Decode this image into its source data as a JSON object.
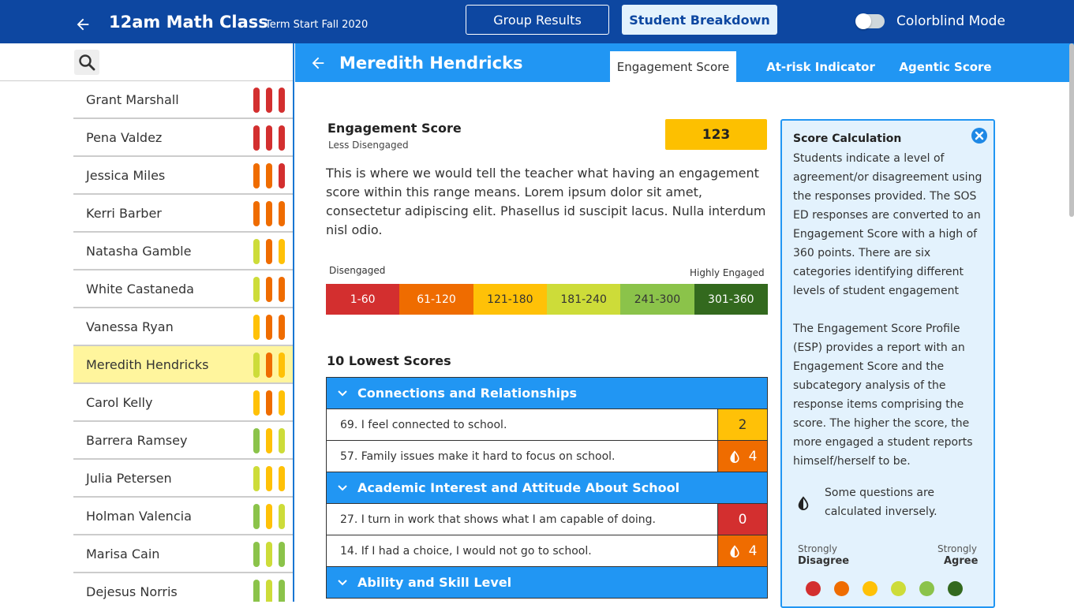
{
  "header": {
    "title": "12am Math Class",
    "term": "Term Start Fall 2020",
    "group_results_label": "Group Results",
    "student_breakdown_label": "Student Breakdown",
    "colorblind_label": "Colorblind Mode",
    "colorblind_on": false
  },
  "sidebar": {
    "students": [
      {
        "name": "Grant Marshall",
        "bars": [
          "#d32f2f",
          "#d32f2f",
          "#d32f2f"
        ]
      },
      {
        "name": "Pena Valdez",
        "bars": [
          "#d32f2f",
          "#d32f2f",
          "#d32f2f"
        ]
      },
      {
        "name": "Jessica Miles",
        "bars": [
          "#ef6c00",
          "#ef6c00",
          "#d32f2f"
        ]
      },
      {
        "name": "Kerri Barber",
        "bars": [
          "#ef6c00",
          "#ef6c00",
          "#ef6c00"
        ]
      },
      {
        "name": "Natasha Gamble",
        "bars": [
          "#cddc39",
          "#ef6c00",
          "#ffc107"
        ]
      },
      {
        "name": "White Castaneda",
        "bars": [
          "#cddc39",
          "#ef6c00",
          "#ef6c00"
        ]
      },
      {
        "name": "Vanessa Ryan",
        "bars": [
          "#ffc107",
          "#ef6c00",
          "#ef6c00"
        ]
      },
      {
        "name": "Meredith Hendricks",
        "bars": [
          "#cddc39",
          "#ef6c00",
          "#ffc107"
        ],
        "selected": true
      },
      {
        "name": "Carol Kelly",
        "bars": [
          "#ffc107",
          "#ef6c00",
          "#ffc107"
        ]
      },
      {
        "name": "Barrera Ramsey",
        "bars": [
          "#8bc34a",
          "#ffc107",
          "#cddc39"
        ]
      },
      {
        "name": "Julia Petersen",
        "bars": [
          "#cddc39",
          "#ffc107",
          "#ffc107"
        ]
      },
      {
        "name": "Holman Valencia",
        "bars": [
          "#8bc34a",
          "#ffc107",
          "#cddc39"
        ]
      },
      {
        "name": "Marisa Cain",
        "bars": [
          "#8bc34a",
          "#cddc39",
          "#8bc34a"
        ]
      },
      {
        "name": "Dejesus Norris",
        "bars": [
          "#8bc34a",
          "#cddc39",
          "#8bc34a"
        ]
      }
    ]
  },
  "detail": {
    "student_name": "Meredith Hendricks",
    "tabs": [
      {
        "label": "Engagement Score",
        "active": true
      },
      {
        "label": "At-risk Indicator",
        "active": false
      },
      {
        "label": "Agentic Score",
        "active": false
      }
    ],
    "engagement": {
      "title": "Engagement Score",
      "subtitle": "Less Disengaged",
      "score": "123",
      "score_color": "#fdc000",
      "description": "This is where we would tell the teacher what having an engagement score within this range means. Lorem ipsum dolor sit amet, consectetur adipiscing elit. Phasellus id suscipit lacus. Nulla interdum nisl odio."
    },
    "scale": {
      "left_label": "Disengaged",
      "right_label": "Highly Engaged",
      "segments": [
        {
          "label": "1-60",
          "color": "#d32f2f",
          "text_color": "#ffffff"
        },
        {
          "label": "61-120",
          "color": "#ef6c00",
          "text_color": "#ffffff"
        },
        {
          "label": "121-180",
          "color": "#ffc107",
          "text_color": "#333333"
        },
        {
          "label": "181-240",
          "color": "#cddc39",
          "text_color": "#333333"
        },
        {
          "label": "241-300",
          "color": "#8bc34a",
          "text_color": "#333333"
        },
        {
          "label": "301-360",
          "color": "#33691e",
          "text_color": "#ffffff"
        }
      ]
    },
    "lowest": {
      "title": "10 Lowest Scores",
      "categories": [
        {
          "label": "Connections and Relationships",
          "questions": [
            {
              "text": "69. I feel connected to school.",
              "score": "2",
              "color": "#ffc107",
              "text_color": "#333333",
              "inverse": false
            },
            {
              "text": "57. Family issues make it hard to focus on school.",
              "score": "4",
              "color": "#ef6c00",
              "text_color": "#ffffff",
              "inverse": true
            }
          ]
        },
        {
          "label": "Academic Interest and Attitude About School",
          "questions": [
            {
              "text": "27. I turn in work that shows what I am capable of doing.",
              "score": "0",
              "color": "#d32f2f",
              "text_color": "#ffffff",
              "inverse": false
            },
            {
              "text": "14. If I had a choice, I would not go to school.",
              "score": "4",
              "color": "#ef6c00",
              "text_color": "#ffffff",
              "inverse": true
            }
          ]
        },
        {
          "label": "Ability and Skill Level",
          "questions": []
        }
      ]
    }
  },
  "calc": {
    "title": "Score Calculation",
    "paragraph1": "Students indicate a level of agreement/or disagreement using the responses provided. The SOS ED responses are converted to an Engagement Score with a high of 360 points. There are six categories identifying different levels of student engagement",
    "paragraph2": "The Engagement Score Profile (ESP) provides a report with an Engagement Score and the subcategory analysis of the response items comprising the score. The higher the score, the more engaged a student reports himself/herself to be.",
    "inverse_note": "Some questions are calculated inversely.",
    "strongly_disagree_top": "Strongly",
    "strongly_disagree_bottom": "Disagree",
    "strongly_agree_top": "Strongly",
    "strongly_agree_bottom": "Agree",
    "dot_colors": [
      "#d32f2f",
      "#ef6c00",
      "#ffc107",
      "#cddc39",
      "#8bc34a",
      "#33691e"
    ]
  }
}
